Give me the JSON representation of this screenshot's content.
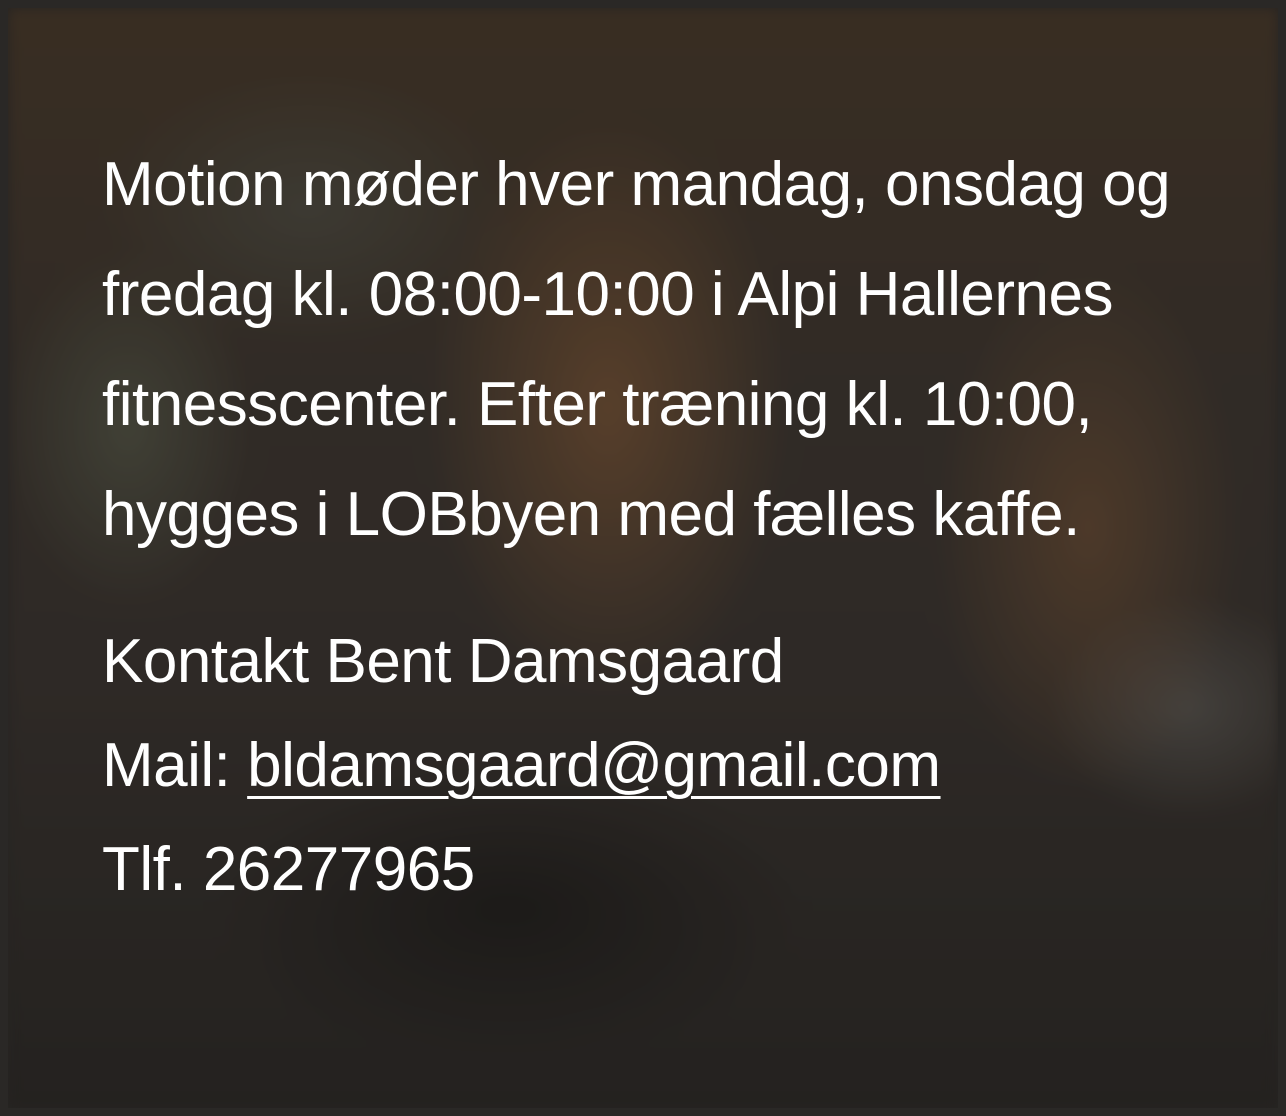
{
  "description": {
    "text": "Motion møder hver mandag, onsdag og fredag kl. 08:00-10:00 i Alpi Hallernes fitnesscenter. Efter træning kl. 10:00, hygges i LOBbyen med fælles kaffe."
  },
  "contact": {
    "name_line": "Kontakt Bent Damsgaard",
    "mail_label": "Mail: ",
    "mail_address": "bldamsgaard@gmail.com",
    "phone_line": "Tlf. 26277965"
  },
  "colors": {
    "text": "#ffffff",
    "frame": "#2a2826"
  }
}
